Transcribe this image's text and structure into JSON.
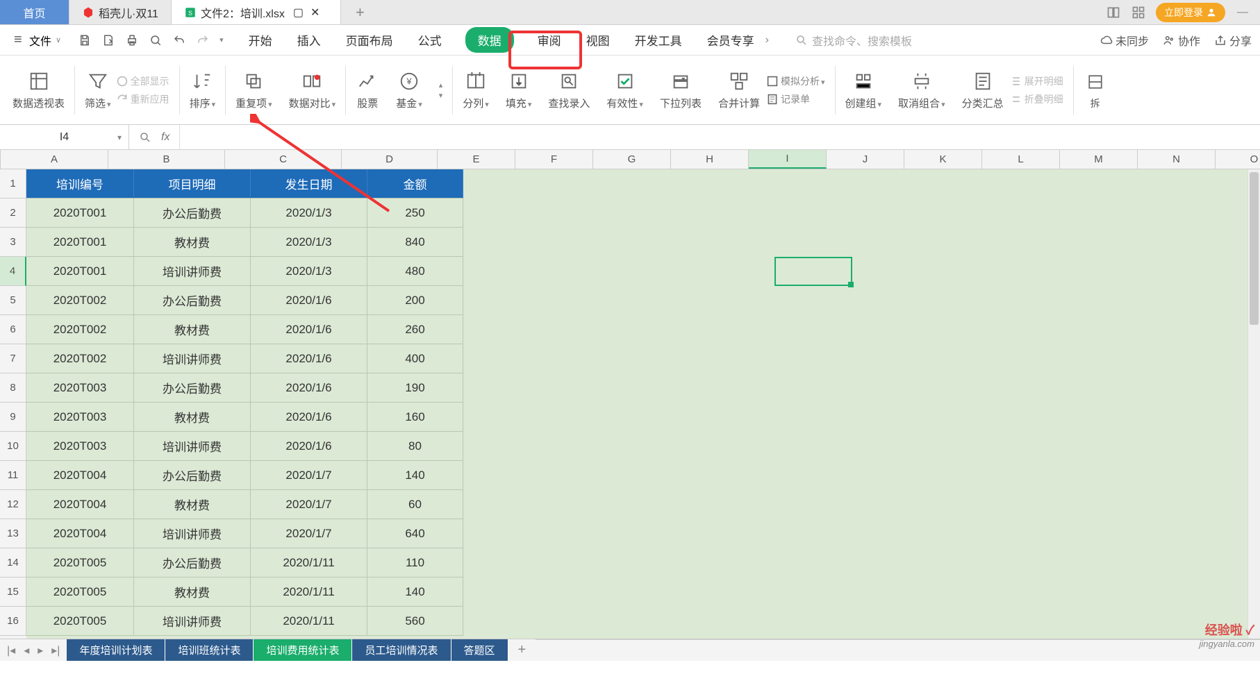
{
  "titlebar": {
    "home": "首页",
    "tab1": "稻壳儿·双11",
    "tab2": "文件2：培训.xlsx",
    "login": "立即登录"
  },
  "menubar": {
    "file": "文件",
    "tabs": [
      "开始",
      "插入",
      "页面布局",
      "公式",
      "数据",
      "审阅",
      "视图",
      "开发工具",
      "会员专享"
    ],
    "active_index": 4,
    "search_placeholder": "查找命令、搜索模板",
    "unsync": "未同步",
    "collab": "协作",
    "share": "分享"
  },
  "ribbon": {
    "pivot": "数据透视表",
    "filter": "筛选",
    "show_all": "全部显示",
    "reapply": "重新应用",
    "sort": "排序",
    "dup": "重复项",
    "compare": "数据对比",
    "stock": "股票",
    "fund": "基金",
    "split": "分列",
    "fill": "填充",
    "find_entry": "查找录入",
    "validity": "有效性",
    "dropdown": "下拉列表",
    "consolidate": "合并计算",
    "whatif": "模拟分析",
    "record": "记录单",
    "group": "创建组",
    "ungroup": "取消组合",
    "subtotal": "分类汇总",
    "expand": "展开明细",
    "collapse": "折叠明细"
  },
  "formula": {
    "cell_ref": "I4",
    "fx": "fx"
  },
  "grid": {
    "columns": [
      "A",
      "B",
      "C",
      "D",
      "E",
      "F",
      "G",
      "H",
      "I",
      "J",
      "K",
      "L",
      "M",
      "N",
      "O"
    ],
    "col_widths": {
      "A": 155,
      "B": 168,
      "C": 168,
      "D": 138
    },
    "headers": [
      "培训编号",
      "项目明细",
      "发生日期",
      "金额"
    ],
    "rows": [
      [
        "2020T001",
        "办公后勤费",
        "2020/1/3",
        "250"
      ],
      [
        "2020T001",
        "教材费",
        "2020/1/3",
        "840"
      ],
      [
        "2020T001",
        "培训讲师费",
        "2020/1/3",
        "480"
      ],
      [
        "2020T002",
        "办公后勤费",
        "2020/1/6",
        "200"
      ],
      [
        "2020T002",
        "教材费",
        "2020/1/6",
        "260"
      ],
      [
        "2020T002",
        "培训讲师费",
        "2020/1/6",
        "400"
      ],
      [
        "2020T003",
        "办公后勤费",
        "2020/1/6",
        "190"
      ],
      [
        "2020T003",
        "教材费",
        "2020/1/6",
        "160"
      ],
      [
        "2020T003",
        "培训讲师费",
        "2020/1/6",
        "80"
      ],
      [
        "2020T004",
        "办公后勤费",
        "2020/1/7",
        "140"
      ],
      [
        "2020T004",
        "教材费",
        "2020/1/7",
        "60"
      ],
      [
        "2020T004",
        "培训讲师费",
        "2020/1/7",
        "640"
      ],
      [
        "2020T005",
        "办公后勤费",
        "2020/1/11",
        "110"
      ],
      [
        "2020T005",
        "教材费",
        "2020/1/11",
        "140"
      ],
      [
        "2020T005",
        "培训讲师费",
        "2020/1/11",
        "560"
      ]
    ],
    "selected_cell": "I4",
    "selected_row": 4,
    "selected_col": "I"
  },
  "sheets": {
    "tabs": [
      "年度培训计划表",
      "培训班统计表",
      "培训费用统计表",
      "员工培训情况表",
      "答题区"
    ],
    "active_index": 2
  },
  "watermark": {
    "line1": "经验啦 ✓",
    "line2": "jingyanla.com"
  }
}
